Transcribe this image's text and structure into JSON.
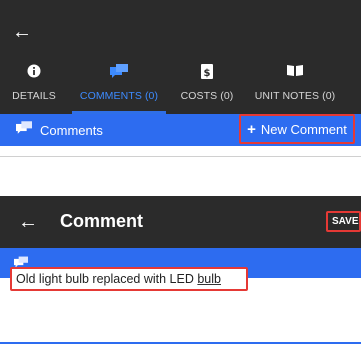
{
  "screen1": {
    "back_icon": "arrow-left-icon",
    "tabs": [
      {
        "label": "DETAILS",
        "icon": "info-icon",
        "active": false
      },
      {
        "label": "COMMENTS (0)",
        "icon": "comments-icon",
        "active": true
      },
      {
        "label": "COSTS (0)",
        "icon": "dollar-document-icon",
        "active": false
      },
      {
        "label": "UNIT NOTES (0)",
        "icon": "book-icon",
        "active": false
      }
    ],
    "section_title": "Comments",
    "new_comment_label": "New Comment"
  },
  "screen2": {
    "back_icon": "arrow-left-icon",
    "title": "Comment",
    "save_label": "SAVE",
    "comment_text_main": "Old light bulb replaced with LED ",
    "comment_text_flagged": "bulb"
  },
  "colors": {
    "app_bar": "#2b2b2b",
    "accent_blue": "#2d6cf0",
    "active_tab_text": "#3d8bff",
    "highlight_red": "#e53935"
  }
}
